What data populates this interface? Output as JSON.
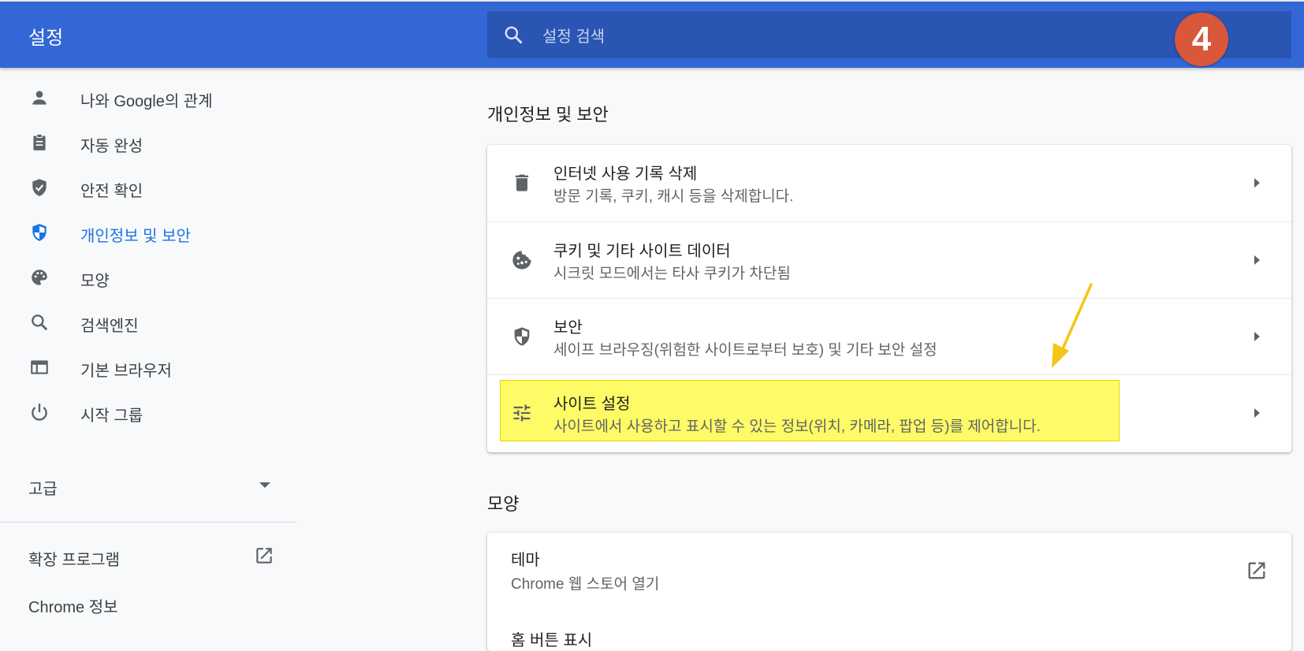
{
  "header": {
    "title": "설정",
    "search_placeholder": "설정 검색",
    "step_badge": "4",
    "badge_color": "#d9573a",
    "brand_color": "#3367d6"
  },
  "sidebar": {
    "items": [
      {
        "label": "나와 Google의 관계",
        "icon": "person-icon",
        "active": false
      },
      {
        "label": "자동 완성",
        "icon": "clipboard-icon",
        "active": false
      },
      {
        "label": "안전 확인",
        "icon": "shield-check-icon",
        "active": false
      },
      {
        "label": "개인정보 및 보안",
        "icon": "shield-icon",
        "active": true
      },
      {
        "label": "모양",
        "icon": "palette-icon",
        "active": false
      },
      {
        "label": "검색엔진",
        "icon": "search-icon",
        "active": false
      },
      {
        "label": "기본 브라우저",
        "icon": "browser-icon",
        "active": false
      },
      {
        "label": "시작 그룹",
        "icon": "power-icon",
        "active": false
      }
    ],
    "advanced_label": "고급",
    "extensions_label": "확장 프로그램",
    "about_label": "Chrome 정보",
    "active_color": "#1a73e8"
  },
  "privacy": {
    "section_title": "개인정보 및 보안",
    "rows": [
      {
        "title": "인터넷 사용 기록 삭제",
        "subtitle": "방문 기록, 쿠키, 캐시 등을 삭제합니다.",
        "icon": "trash-icon"
      },
      {
        "title": "쿠키 및 기타 사이트 데이터",
        "subtitle": "시크릿 모드에서는 타사 쿠키가 차단됨",
        "icon": "cookie-icon"
      },
      {
        "title": "보안",
        "subtitle": "세이프 브라우징(위험한 사이트로부터 보호) 및 기타 보안 설정",
        "icon": "security-shield-icon"
      },
      {
        "title": "사이트 설정",
        "subtitle": "사이트에서 사용하고 표시할 수 있는 정보(위치, 카메라, 팝업 등)를 제어합니다.",
        "icon": "tune-icon",
        "highlighted": true
      }
    ],
    "highlight_color": "#fffb66"
  },
  "appearance": {
    "section_title": "모양",
    "theme_title": "테마",
    "theme_subtitle": "Chrome 웹 스토어 열기",
    "next_row_title": "홈 버튼 표시"
  }
}
